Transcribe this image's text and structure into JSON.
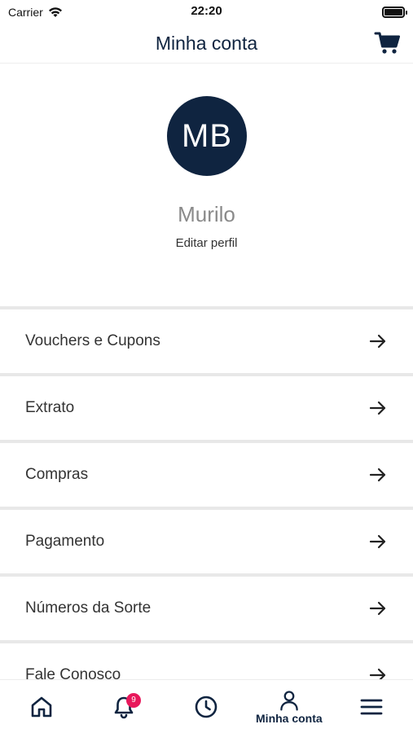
{
  "status_bar": {
    "carrier": "Carrier",
    "time": "22:20"
  },
  "header": {
    "title": "Minha conta",
    "cart_icon": "cart-icon"
  },
  "profile": {
    "initials": "MB",
    "name": "Murilo",
    "edit_label": "Editar perfil"
  },
  "menu": {
    "items": [
      {
        "label": "Vouchers e Cupons"
      },
      {
        "label": "Extrato"
      },
      {
        "label": "Compras"
      },
      {
        "label": "Pagamento"
      },
      {
        "label": "Números da Sorte"
      },
      {
        "label": "Fale Conosco"
      }
    ]
  },
  "tabbar": {
    "notification_count": "9",
    "account_label": "Minha conta"
  },
  "colors": {
    "brand": "#0f2440",
    "badge": "#e8185b",
    "divider": "#e8e8e8"
  }
}
